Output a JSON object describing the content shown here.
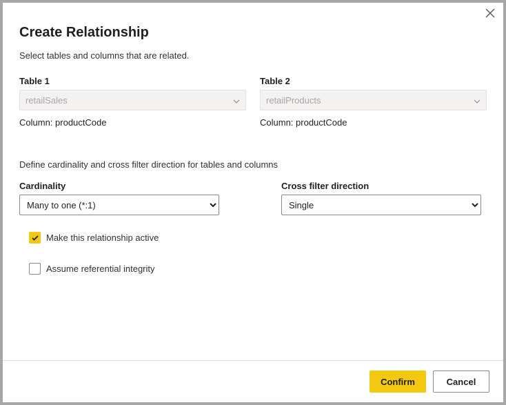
{
  "dialog": {
    "title": "Create Relationship",
    "subtitle": "Select tables and columns that are related.",
    "close_icon": "close"
  },
  "table1": {
    "label": "Table 1",
    "value": "retailSales",
    "column_prefix": "Column: ",
    "column_value": "productCode"
  },
  "table2": {
    "label": "Table 2",
    "value": "retailProducts",
    "column_prefix": "Column: ",
    "column_value": "productCode"
  },
  "section2_text": "Define cardinality and cross filter direction for tables and columns",
  "cardinality": {
    "label": "Cardinality",
    "value": "Many to one (*:1)"
  },
  "crossfilter": {
    "label": "Cross filter direction",
    "value": "Single"
  },
  "check_active": {
    "label": "Make this relationship active",
    "checked": true
  },
  "check_ref": {
    "label": "Assume referential integrity",
    "checked": false
  },
  "buttons": {
    "confirm": "Confirm",
    "cancel": "Cancel"
  }
}
